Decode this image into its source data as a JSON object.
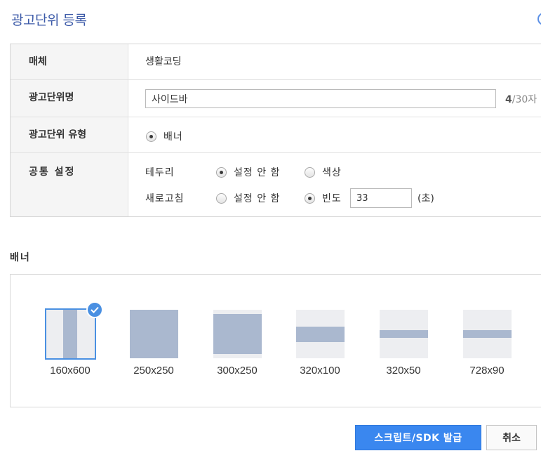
{
  "page": {
    "title": "광고단위 등록"
  },
  "form": {
    "media": {
      "label": "매체",
      "value": "생활코딩"
    },
    "unit_name": {
      "label": "광고단위명",
      "value": "사이드바",
      "count_current": "4",
      "count_rest": "/30자"
    },
    "unit_type": {
      "label": "광고단위 유형",
      "option": "배너",
      "selected": true
    },
    "common": {
      "label": "공통 설정",
      "border": {
        "label": "테두리",
        "options": [
          "설정 안 함",
          "색상"
        ],
        "selected": "설정 안 함"
      },
      "refresh": {
        "label": "새로고침",
        "options": [
          "설정 안 함",
          "빈도"
        ],
        "selected": "빈도",
        "frequency": "33",
        "unit": "(초)"
      }
    }
  },
  "banner": {
    "title": "배너",
    "sizes": [
      {
        "label": "160x600",
        "selected": true
      },
      {
        "label": "250x250",
        "selected": false
      },
      {
        "label": "300x250",
        "selected": false
      },
      {
        "label": "320x100",
        "selected": false
      },
      {
        "label": "320x50",
        "selected": false
      },
      {
        "label": "728x90",
        "selected": false
      }
    ]
  },
  "buttons": {
    "submit": "스크립트/SDK 발급",
    "cancel": "취소"
  },
  "colors": {
    "accent": "#3a87ef",
    "title": "#3c5aa8",
    "thumb_fill": "#aab8cf",
    "thumb_bg": "#edeef1"
  }
}
